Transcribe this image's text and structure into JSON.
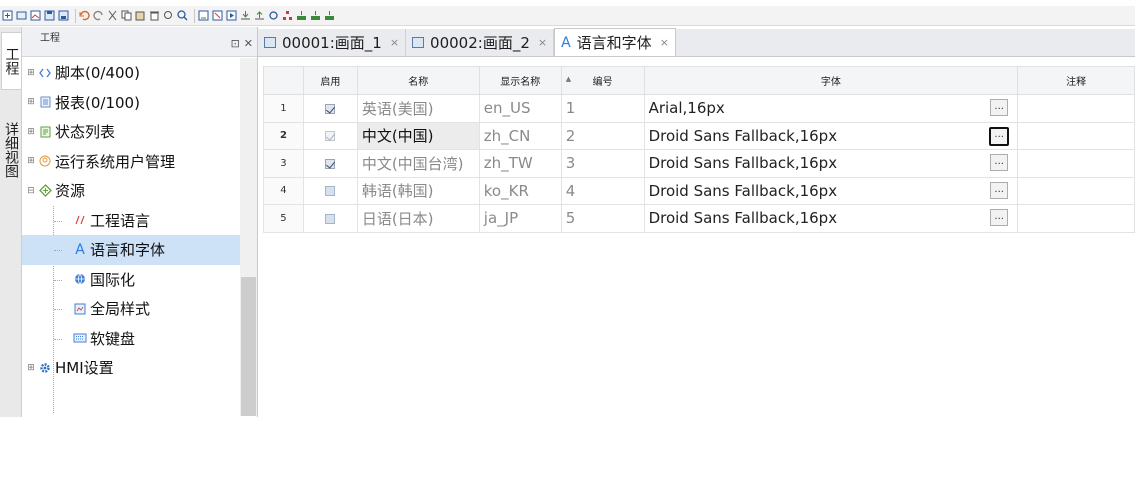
{
  "side_tabs": [
    "工程",
    "详细视图"
  ],
  "project_panel": {
    "title": "工程",
    "pin_glyph": "⊡",
    "close_glyph": "✕",
    "tree": [
      {
        "label": "脚本(0/400)",
        "icon": "script-icon",
        "level": 0,
        "expander": "⊞"
      },
      {
        "label": "报表(0/100)",
        "icon": "report-icon",
        "level": 0,
        "expander": "⊞"
      },
      {
        "label": "状态列表",
        "icon": "status-list-icon",
        "level": 0,
        "expander": "⊞"
      },
      {
        "label": "运行系统用户管理",
        "icon": "user-management-icon",
        "level": 0,
        "expander": "⊞"
      },
      {
        "label": "资源",
        "icon": "resources-icon",
        "level": 0,
        "expander": "⊟"
      },
      {
        "label": "工程语言",
        "icon": "project-language-icon",
        "level": 1
      },
      {
        "label": "语言和字体",
        "icon": "language-font-icon",
        "level": 1,
        "selected": true
      },
      {
        "label": "国际化",
        "icon": "globe-icon",
        "level": 1
      },
      {
        "label": "全局样式",
        "icon": "global-style-icon",
        "level": 1
      },
      {
        "label": "软键盘",
        "icon": "keyboard-icon",
        "level": 1
      },
      {
        "label": "HMI设置",
        "icon": "gear-icon",
        "level": 0,
        "expander": "⊞"
      }
    ]
  },
  "tabs": [
    {
      "label": "00001:画面_1",
      "icon": "screen-icon",
      "close": "×"
    },
    {
      "label": "00002:画面_2",
      "icon": "screen-icon",
      "close": "×"
    },
    {
      "label": "语言和字体",
      "icon": "language-font-icon",
      "close": "×",
      "active": true
    }
  ],
  "grid": {
    "columns": [
      "启用",
      "名称",
      "显示名称",
      "编号",
      "字体",
      "注释"
    ],
    "sort_indicator": "▲",
    "ellipsis": "...",
    "rows": [
      {
        "num": "1",
        "enabled": true,
        "enabled_disabled": false,
        "name": "英语(美国)",
        "display": "en_US",
        "code": "1",
        "font": "Arial,16px",
        "comment": ""
      },
      {
        "num": "2",
        "enabled": true,
        "enabled_disabled": true,
        "name": "中文(中国)",
        "display": "zh_CN",
        "code": "2",
        "font": "Droid Sans Fallback,16px",
        "comment": "",
        "selected": true
      },
      {
        "num": "3",
        "enabled": true,
        "enabled_disabled": false,
        "name": "中文(中国台湾)",
        "display": "zh_TW",
        "code": "3",
        "font": "Droid Sans Fallback,16px",
        "comment": ""
      },
      {
        "num": "4",
        "enabled": false,
        "enabled_disabled": false,
        "name": "韩语(韩国)",
        "display": "ko_KR",
        "code": "4",
        "font": "Droid Sans Fallback,16px",
        "comment": ""
      },
      {
        "num": "5",
        "enabled": false,
        "enabled_disabled": false,
        "name": "日语(日本)",
        "display": "ja_JP",
        "code": "5",
        "font": "Droid Sans Fallback,16px",
        "comment": ""
      }
    ]
  },
  "colors": {
    "accent": "#2a7be4",
    "selection": "#cde1f7",
    "focus_border": "#111111"
  }
}
